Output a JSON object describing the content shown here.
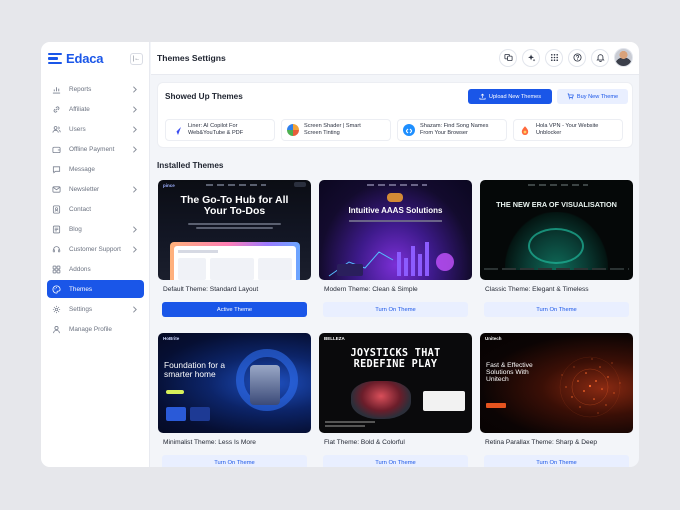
{
  "app": {
    "name": "Edaca",
    "collapse_icon": "collapse-sidebar-icon"
  },
  "sidebar": {
    "items": [
      {
        "label": "Reports",
        "icon": "chart-icon",
        "chevron": true,
        "active": false
      },
      {
        "label": "Affiliate",
        "icon": "link-icon",
        "chevron": true,
        "active": false
      },
      {
        "label": "Users",
        "icon": "users-icon",
        "chevron": true,
        "active": false
      },
      {
        "label": "Offline Payment",
        "icon": "wallet-icon",
        "chevron": true,
        "active": false
      },
      {
        "label": "Message",
        "icon": "message-icon",
        "chevron": false,
        "active": false
      },
      {
        "label": "Newsletter",
        "icon": "newsletter-icon",
        "chevron": true,
        "active": false
      },
      {
        "label": "Contact",
        "icon": "contact-icon",
        "chevron": false,
        "active": false
      },
      {
        "label": "Blog",
        "icon": "blog-icon",
        "chevron": true,
        "active": false
      },
      {
        "label": "Customer Support",
        "icon": "headset-icon",
        "chevron": true,
        "active": false
      },
      {
        "label": "Addons",
        "icon": "puzzle-icon",
        "chevron": false,
        "active": false
      },
      {
        "label": "Themes",
        "icon": "palette-icon",
        "chevron": false,
        "active": true
      },
      {
        "label": "Settings",
        "icon": "gear-icon",
        "chevron": true,
        "active": false
      },
      {
        "label": "Manage Profile",
        "icon": "profile-icon",
        "chevron": false,
        "active": false
      }
    ]
  },
  "header": {
    "title": "Themes Settigns",
    "icons": [
      "translate-icon",
      "sparkle-icon",
      "apps-grid-icon",
      "help-icon",
      "bell-icon"
    ]
  },
  "shown_panel": {
    "title": "Showed Up Themes",
    "upload_label": "Upload New Themes",
    "buy_label": "Buy New Theme",
    "items": [
      {
        "line1": "Liner: AI Copilot For",
        "line2": "Web&YouTube & PDF",
        "icon": "liner-logo-icon",
        "color": "#3b4cf0"
      },
      {
        "line1": "Screen Shader | Smart",
        "line2": "Screen Tinting",
        "icon": "screen-shader-logo-icon",
        "color": "#f2a33a"
      },
      {
        "line1": "Shazam: Find Song Names",
        "line2": "From Your Browser",
        "icon": "shazam-logo-icon",
        "color": "#1e8fff"
      },
      {
        "line1": "Hola VPN - Your Website",
        "line2": "Unblocker",
        "icon": "hola-logo-icon",
        "color": "#ff6a3d"
      }
    ]
  },
  "installed": {
    "title": "Installed Themes",
    "themes": [
      {
        "name": "Default Theme: Standard Layout",
        "button": "Active Theme",
        "active": true,
        "preview_headline": "The Go-To Hub for All Your To-Dos",
        "preview_brand": "pince"
      },
      {
        "name": "Modern Theme: Clean & Simple",
        "button": "Turn On Theme",
        "active": false,
        "preview_headline": "Intuitive AAAS Solutions",
        "preview_brand": ""
      },
      {
        "name": "Classic Theme: Elegant & Timeless",
        "button": "Turn On Theme",
        "active": false,
        "preview_headline": "THE NEW ERA OF VISUALISATION",
        "preview_brand": ""
      },
      {
        "name": "Minimalist Theme: Less Is More",
        "button": "Turn On Theme",
        "active": false,
        "preview_headline": "Foundation for a smarter home",
        "preview_brand": "HoBrite"
      },
      {
        "name": "Flat Theme: Bold & Colorful",
        "button": "Turn On Theme",
        "active": false,
        "preview_headline": "JOYSTICKS THAT REDEFINE PLAY",
        "preview_brand": "BELLEZA"
      },
      {
        "name": "Retina Parallax Theme: Sharp & Deep",
        "button": "Turn On Theme",
        "active": false,
        "preview_headline": "Fast & Effective Solutions With Unitech",
        "preview_brand": "Unitech"
      }
    ]
  },
  "colors": {
    "accent": "#1a56e8",
    "accent_soft": "#e9efff",
    "background": "#f3f5f9"
  }
}
